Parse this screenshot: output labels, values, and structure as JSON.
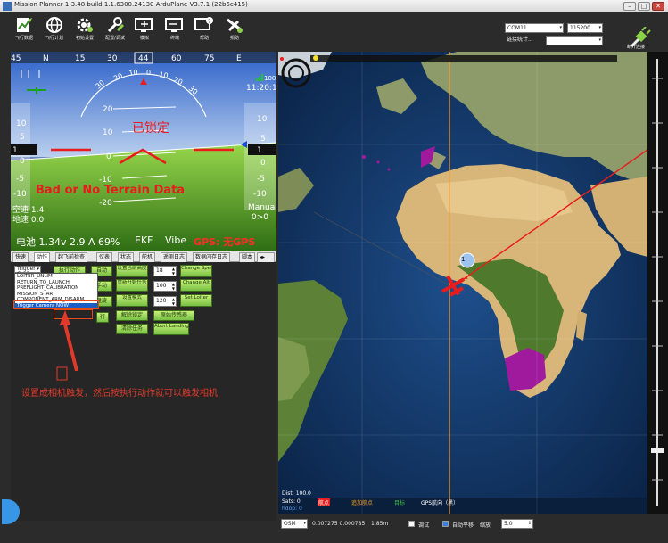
{
  "window": {
    "title": "Mission Planner 1.3.48 build 1.1.6300.24130 ArduPlane V3.7.1 (22b5c415)",
    "controls": [
      "–",
      "□",
      "✕"
    ]
  },
  "toolbar": {
    "buttons": [
      {
        "label": "飞行数据",
        "icon": "flight-data-icon"
      },
      {
        "label": "飞行计划",
        "icon": "globe-icon"
      },
      {
        "label": "初始设置",
        "icon": "gear-icon"
      },
      {
        "label": "配置/调试",
        "icon": "wrench-icon"
      },
      {
        "label": "模拟",
        "icon": "monitor-plane-icon"
      },
      {
        "label": "终端",
        "icon": "terminal-icon"
      },
      {
        "label": "帮助",
        "icon": "help-icon"
      },
      {
        "label": "捐助",
        "icon": "donate-plane-icon"
      }
    ],
    "port": "COM11",
    "baud": "115200",
    "link_stats": "链接统计...",
    "connect_label": "断开连接"
  },
  "hud": {
    "heading_ticks": [
      "45",
      "N",
      "15",
      "30",
      "44",
      "60",
      "75",
      "E"
    ],
    "current_heading": "44",
    "pitch_labels": [
      "20",
      "10",
      "0",
      "-10",
      "-20"
    ],
    "roll_labels": [
      "30",
      "20",
      "10",
      "0",
      "10",
      "20",
      "30"
    ],
    "left_scale": [
      "10",
      "5",
      "1",
      "0",
      "-5",
      "-10"
    ],
    "right_scale": [
      "10",
      "5",
      "1",
      "0",
      "-5",
      "-10"
    ],
    "speed_value": "1",
    "alt_value": "1",
    "battery_top": "100%",
    "time": "11:20:13",
    "disarmed": "已锁定",
    "terrain": "Bad or No Terrain Data",
    "airspeed": "空速 1.4",
    "groundspeed": "地速 0.0",
    "mode": "Manual",
    "mode_sub": "0>0",
    "status_battery": "电池 1.34v 2.9 A 69%",
    "ekf": "EKF",
    "vibe": "Vibe",
    "gps": "GPS: 无GPS"
  },
  "tabs": [
    "快速",
    "动作",
    "起飞前检查",
    "仪表",
    "状态",
    "舵机",
    "遥测日志",
    "数据闪存日志",
    "脚本"
  ],
  "actions": {
    "dropdown_value": "Trigger C",
    "dropdown_items": [
      "LOITER_UNLIM",
      "RETURN_TO_LAUNCH",
      "PREFLIGHT_CALIBRATION",
      "MISSION_START",
      "COMPONENT_ARM_DISARM",
      "Trigger Camera NOW"
    ],
    "buttons": {
      "execute": "执行动作",
      "auto": "自动",
      "set_home_alt": "设置当前高度",
      "manual": "手动",
      "restart_mission": "重新开始任务",
      "preflight": "预飞",
      "set_mode": "设置模式",
      "loiter": "盘旋",
      "disarm": "解除锁定",
      "raw_sensor": "原始传感器",
      "clear_mission": "清除任务",
      "abort_landing": "Abort Landing",
      "change_speed": "Change Speed",
      "change_alt": "Change Alt",
      "set_loiter_rad": "Set Loiter",
      "extra": "行"
    },
    "num_speed": "18",
    "num_alt": "100",
    "num_loiter": "120",
    "annotation": "设置成相机触发，然后按执行动作就可以触发相机"
  },
  "map": {
    "dist": "Dist: 100.0",
    "sats": "Sats: 0",
    "hdop": "hdop: 0",
    "legend": [
      "航点",
      "追加航点",
      "目标",
      "GPS航向（黑）"
    ],
    "waypoint_num": "1"
  },
  "bottombar": {
    "map_type": "OSM",
    "coords": "0.007275 0.000785",
    "dist": "1.85m",
    "debug_label": "调试",
    "autopan_label": "自动平移",
    "zoom_label": "缩放",
    "zoom_value": "5.0"
  },
  "colors": {
    "accent_green": "#77c043",
    "hud_red": "#e81c1c",
    "status_red": "#ff2a2a",
    "annotation_red": "#e23a2a",
    "purple": "#a01a9e"
  }
}
